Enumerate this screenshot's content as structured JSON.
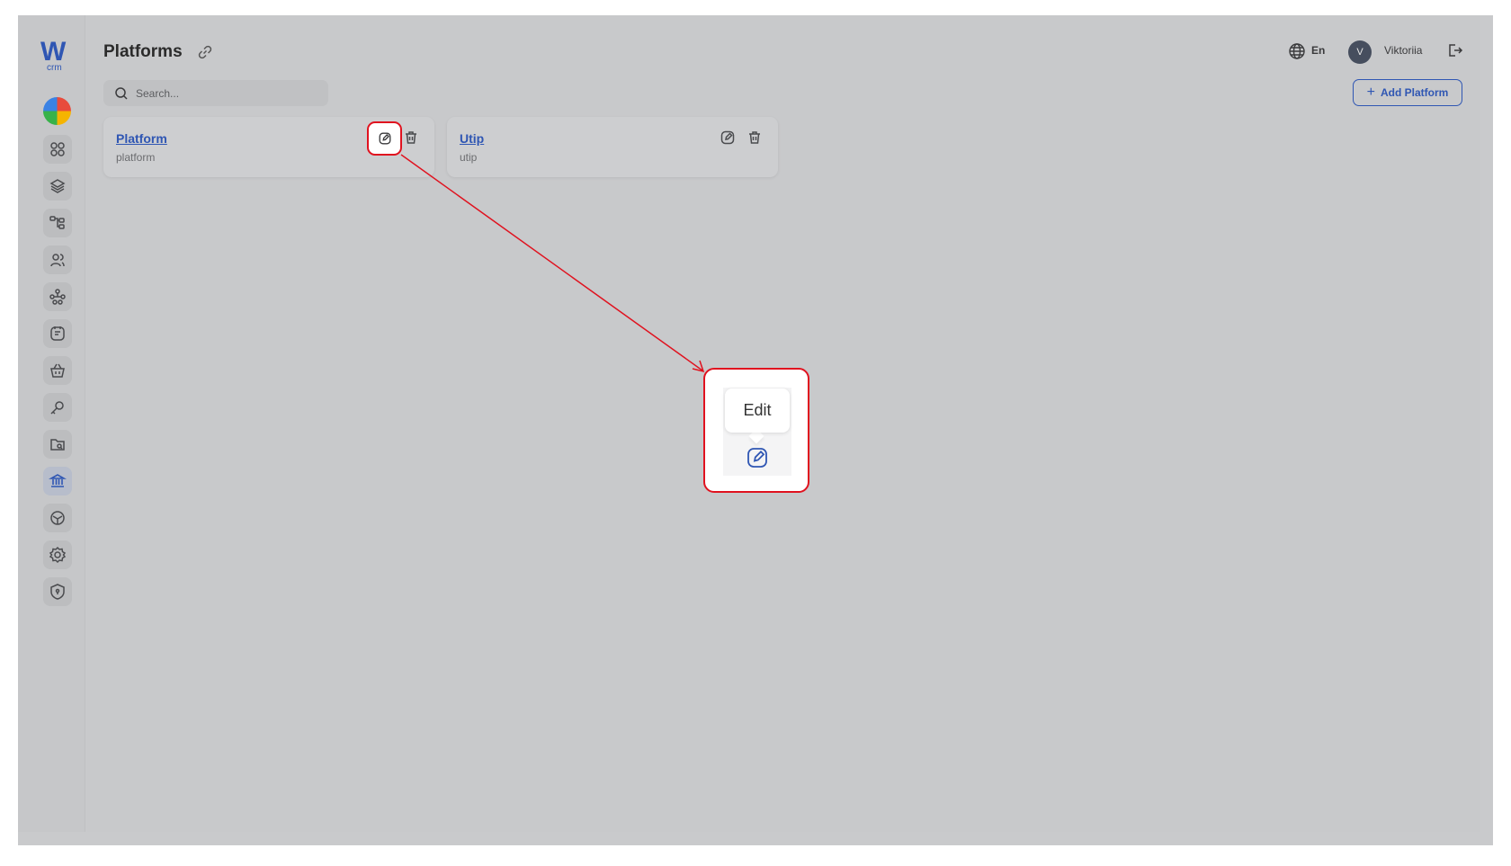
{
  "app": {
    "logo_letter": "W",
    "logo_sub": "crm"
  },
  "sidebar": {
    "items": [
      {
        "icon": "dashboard-icon",
        "active": false
      },
      {
        "icon": "layers-icon",
        "active": false
      },
      {
        "icon": "hierarchy-icon",
        "active": false
      },
      {
        "icon": "users-icon",
        "active": false
      },
      {
        "icon": "network-icon",
        "active": false
      },
      {
        "icon": "note-icon",
        "active": false
      },
      {
        "icon": "basket-icon",
        "active": false
      },
      {
        "icon": "key-icon",
        "active": false
      },
      {
        "icon": "folder-search-icon",
        "active": false
      },
      {
        "icon": "bank-icon",
        "active": true
      },
      {
        "icon": "box-icon",
        "active": false
      },
      {
        "icon": "settings-icon",
        "active": false
      },
      {
        "icon": "shield-icon",
        "active": false
      }
    ]
  },
  "header": {
    "title": "Platforms",
    "language": "En",
    "avatar_initial": "V",
    "username": "Viktoriia"
  },
  "search": {
    "placeholder": "Search..."
  },
  "toolbar": {
    "add_label": "Add Platform"
  },
  "cards": [
    {
      "title": "Platform",
      "subtitle": "platform"
    },
    {
      "title": "Utip",
      "subtitle": "utip"
    }
  ],
  "annotation": {
    "tooltip_label": "Edit"
  },
  "colors": {
    "accent": "#2f56b3",
    "highlight": "#e0121f",
    "overlay_bg": "#c9cacc"
  }
}
